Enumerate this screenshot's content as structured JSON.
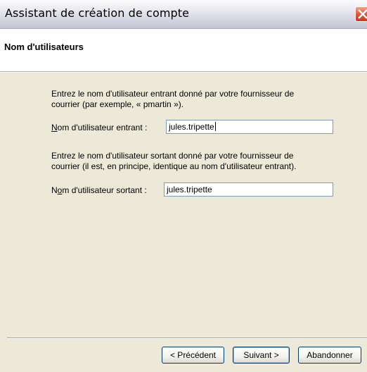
{
  "window": {
    "title": "Assistant de création de compte"
  },
  "header": {
    "title": "Nom d'utilisateurs"
  },
  "incoming": {
    "description_line1": "Entrez le nom d'utilisateur entrant donné par votre fournisseur de",
    "description_line2": "courrier (par exemple, « pmartin »).",
    "label_mnemonic": "N",
    "label_rest": "om d'utilisateur entrant :",
    "value": "jules.tripette"
  },
  "outgoing": {
    "description_line1": "Entrez le nom d'utilisateur sortant donné par votre fournisseur de",
    "description_line2": "courrier (il est, en principe, identique au nom d'utilisateur entrant).",
    "label_pre": "N",
    "label_mnemonic": "o",
    "label_rest": "m d'utilisateur sortant :",
    "value": "jules.tripette"
  },
  "buttons": {
    "back": "< Précédent",
    "next": "Suivant >",
    "cancel": "Abandonner"
  },
  "colors": {
    "dialog_background": "#ece9d8",
    "textbox_border": "#7f9db9",
    "button_border": "#003c74",
    "close_button": "#e0573a"
  }
}
